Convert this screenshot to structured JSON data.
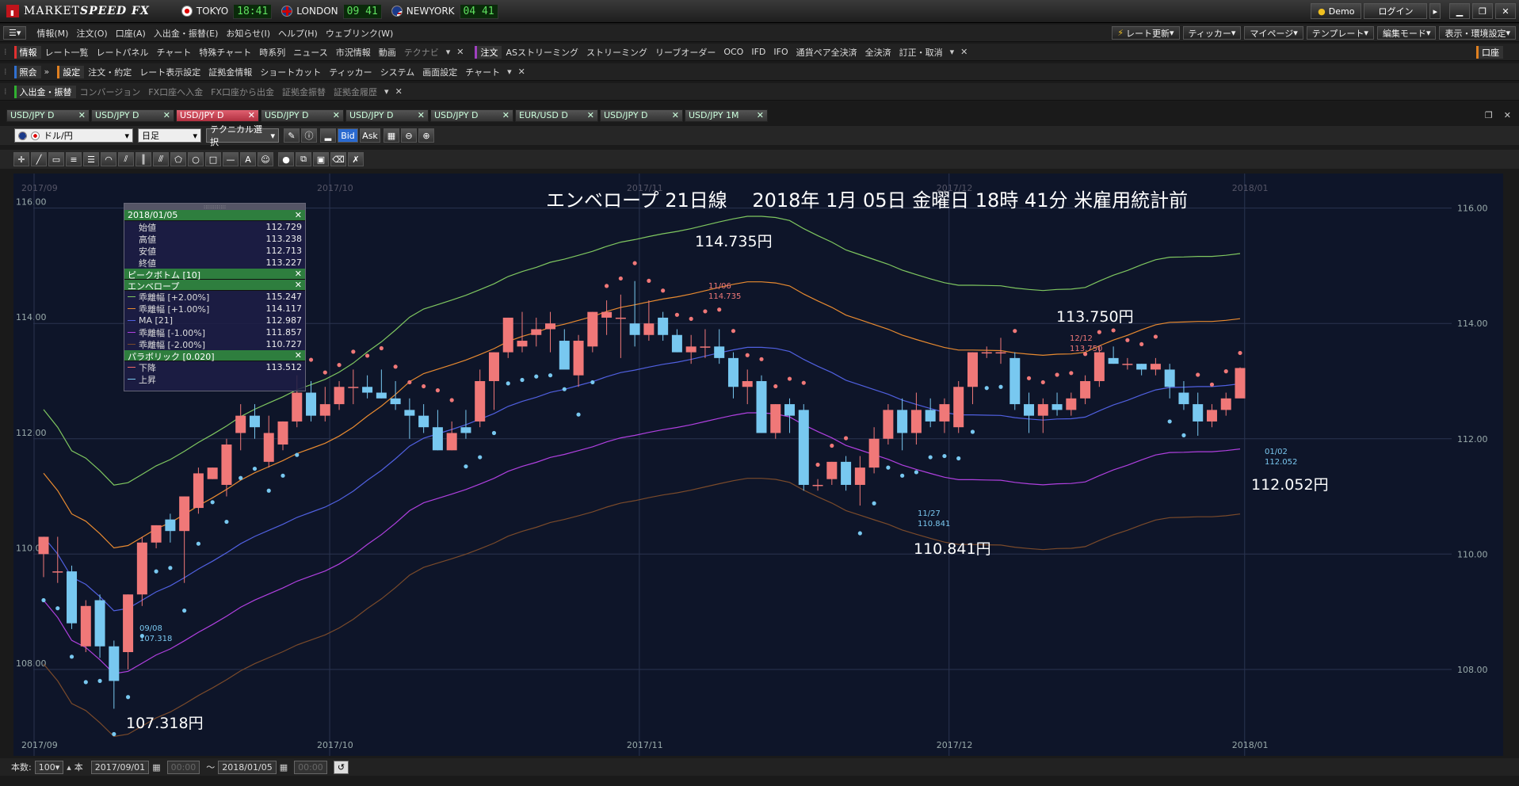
{
  "title_bar": {
    "app_name_a": "MARKET",
    "app_name_b": "SPEED FX",
    "clocks": [
      {
        "city": "TOKYO",
        "time": "18:41"
      },
      {
        "city": "LONDON",
        "time": "09 41"
      },
      {
        "city": "NEWYORK",
        "time": "04 41"
      }
    ],
    "demo_label": "Demo",
    "login_label": "ログイン"
  },
  "menu_row1": {
    "items": [
      "情報(M)",
      "注文(O)",
      "口座(A)",
      "入出金・振替(E)",
      "お知らせ(I)",
      "ヘルプ(H)",
      "ウェブリンク(W)"
    ],
    "right_buttons": [
      "レート更新",
      "ティッカー",
      "マイページ",
      "テンプレート",
      "編集モード",
      "表示・環境設定"
    ]
  },
  "menu_row2": {
    "group1_label": "情報",
    "group1_items": [
      "レート一覧",
      "レートパネル",
      "チャート",
      "特殊チャート",
      "時系列",
      "ニュース",
      "市況情報",
      "動画",
      "テクナビ"
    ],
    "group2_label": "注文",
    "group2_items": [
      "ASストリーミング",
      "ストリーミング",
      "リーブオーダー",
      "OCO",
      "IFD",
      "IFO",
      "通貨ペア全決済",
      "全決済",
      "訂正・取消"
    ],
    "right_label": "口座"
  },
  "menu_row3": {
    "group1_label": "照会",
    "group2_label": "設定",
    "group2_items": [
      "注文・約定",
      "レート表示設定",
      "証拠金情報",
      "ショートカット",
      "ティッカー",
      "システム",
      "画面設定",
      "チャート"
    ]
  },
  "menu_row4": {
    "group1_label": "入出金・振替",
    "group1_items": [
      "コンバージョン",
      "FX口座へ入金",
      "FX口座から出金",
      "証拠金振替",
      "証拠金履歴"
    ]
  },
  "tabs": [
    "USD/JPY D",
    "USD/JPY D",
    "USD/JPY D",
    "USD/JPY D",
    "USD/JPY D",
    "USD/JPY D",
    "EUR/USD D",
    "USD/JPY D",
    "USD/JPY 1M"
  ],
  "active_tab": 2,
  "chart_controls": {
    "pair": "ドル/円",
    "period": "日足",
    "technical": "テクニカル選択",
    "bid": "Bid",
    "ask": "Ask"
  },
  "legend": {
    "date": "2018/01/05",
    "ohlc": [
      {
        "name": "始値",
        "value": "112.729"
      },
      {
        "name": "高値",
        "value": "113.238"
      },
      {
        "name": "安値",
        "value": "112.713"
      },
      {
        "name": "終値",
        "value": "113.227"
      }
    ],
    "peak_bottom": "ピークボトム [10]",
    "envelope_title": "エンベロープ",
    "envelope": [
      {
        "name": "乖離幅 [+2.00%]",
        "value": "115.247",
        "color": "#7fc760"
      },
      {
        "name": "乖離幅 [+1.00%]",
        "value": "114.117",
        "color": "#e88a30"
      },
      {
        "name": "MA [21]",
        "value": "112.987",
        "color": "#5060e0"
      },
      {
        "name": "乖離幅 [-1.00%]",
        "value": "111.857",
        "color": "#b040e0"
      },
      {
        "name": "乖離幅 [-2.00%]",
        "value": "110.727",
        "color": "#7a4a2a"
      }
    ],
    "parabolic_title": "パラボリック [0.020]",
    "parabolic": [
      {
        "name": "下降",
        "value": "113.512",
        "color": "#f06a6a"
      },
      {
        "name": "上昇",
        "value": "",
        "color": "#7ac8f0"
      }
    ]
  },
  "headline": "エンベロープ 21日線　 2018年 1月 05日 金曜日 18時 41分 米雇用統計前",
  "annotations": {
    "a1": "114.735円",
    "a2": "113.750円",
    "a3": "112.052円",
    "a4": "110.841円",
    "a5": "107.318円",
    "p1_date": "11/06",
    "p1_val": "114.735",
    "p2_date": "12/12",
    "p2_val": "113.750",
    "p3_date": "01/02",
    "p3_val": "112.052",
    "p4_date": "11/27",
    "p4_val": "110.841",
    "p5_date": "09/08",
    "p5_val": "107.318"
  },
  "colors": {
    "up": "#f07878",
    "down": "#78c8f0",
    "bg": "#0e1529"
  },
  "footer": {
    "count_label": "本数:",
    "count_value": "100",
    "unit": "本",
    "from_date": "2017/09/01",
    "from_time": "00:00",
    "tilde": "〜",
    "to_date": "2018/01/05",
    "to_time": "00:00"
  },
  "chart_data": {
    "type": "candlestick",
    "y_ticks": [
      "116.00",
      "114.00",
      "112.00",
      "110.00",
      "108.00"
    ],
    "ylim": [
      106.5,
      116.6
    ],
    "x_ticks": [
      "2017/09",
      "2017/10",
      "2017/11",
      "2017/12",
      "2018/01"
    ],
    "candles": [
      [
        110.0,
        110.3,
        109.6,
        110.3
      ],
      [
        109.7,
        110.3,
        109.5,
        109.7
      ],
      [
        109.7,
        109.8,
        108.7,
        108.8
      ],
      [
        108.4,
        109.2,
        108.3,
        109.1
      ],
      [
        109.2,
        109.3,
        108.2,
        108.4
      ],
      [
        108.4,
        108.5,
        107.318,
        107.8
      ],
      [
        108.3,
        109.3,
        108.0,
        109.3
      ],
      [
        109.3,
        110.3,
        109.1,
        110.2
      ],
      [
        110.2,
        110.5,
        110.1,
        110.5
      ],
      [
        110.6,
        110.7,
        110.2,
        110.4
      ],
      [
        110.4,
        111.0,
        109.5,
        111.0
      ],
      [
        110.8,
        111.5,
        110.7,
        111.4
      ],
      [
        111.3,
        111.5,
        111.3,
        111.5
      ],
      [
        111.2,
        112.0,
        111.0,
        111.9
      ],
      [
        112.1,
        112.6,
        111.8,
        112.4
      ],
      [
        112.4,
        112.6,
        112.0,
        112.2
      ],
      [
        111.6,
        112.4,
        111.5,
        112.1
      ],
      [
        111.9,
        112.3,
        111.8,
        112.3
      ],
      [
        112.3,
        113.1,
        112.2,
        112.8
      ],
      [
        112.8,
        113.0,
        112.3,
        112.4
      ],
      [
        112.4,
        112.9,
        112.3,
        112.6
      ],
      [
        112.6,
        113.0,
        112.5,
        112.9
      ],
      [
        112.9,
        113.2,
        112.6,
        112.9
      ],
      [
        112.9,
        113.1,
        112.7,
        112.8
      ],
      [
        112.8,
        113.2,
        112.7,
        112.7
      ],
      [
        112.7,
        113.0,
        112.5,
        112.6
      ],
      [
        112.5,
        112.7,
        112.0,
        112.4
      ],
      [
        112.4,
        112.6,
        112.1,
        112.2
      ],
      [
        112.2,
        112.5,
        111.8,
        111.8
      ],
      [
        111.8,
        112.3,
        111.8,
        112.1
      ],
      [
        112.2,
        112.5,
        112.0,
        112.1
      ],
      [
        112.3,
        113.2,
        112.2,
        113.0
      ],
      [
        113.0,
        113.5,
        112.5,
        113.5
      ],
      [
        113.5,
        114.1,
        113.4,
        114.1
      ],
      [
        113.6,
        114.2,
        113.5,
        113.7
      ],
      [
        113.8,
        114.1,
        113.6,
        113.9
      ],
      [
        113.9,
        114.2,
        113.5,
        114.0
      ],
      [
        113.7,
        113.9,
        113.3,
        113.2
      ],
      [
        113.1,
        113.8,
        112.9,
        113.7
      ],
      [
        113.6,
        114.2,
        113.5,
        114.2
      ],
      [
        114.1,
        114.4,
        113.8,
        114.2
      ],
      [
        114.1,
        114.5,
        113.4,
        114.1
      ],
      [
        114.0,
        114.735,
        113.6,
        113.8
      ],
      [
        113.8,
        114.4,
        113.7,
        114.0
      ],
      [
        114.1,
        114.2,
        113.7,
        113.8
      ],
      [
        113.8,
        113.9,
        113.5,
        113.5
      ],
      [
        113.5,
        113.8,
        113.3,
        113.6
      ],
      [
        113.6,
        113.9,
        113.4,
        113.6
      ],
      [
        113.6,
        113.9,
        113.3,
        113.4
      ],
      [
        113.4,
        113.5,
        112.7,
        112.9
      ],
      [
        112.9,
        113.2,
        112.6,
        113.0
      ],
      [
        113.0,
        113.1,
        112.1,
        112.1
      ],
      [
        112.1,
        112.6,
        112.0,
        112.6
      ],
      [
        112.6,
        112.7,
        112.1,
        112.4
      ],
      [
        112.5,
        112.6,
        111.1,
        111.2
      ],
      [
        111.2,
        111.3,
        111.1,
        111.2
      ],
      [
        111.3,
        111.6,
        111.2,
        111.6
      ],
      [
        111.6,
        111.7,
        111.1,
        111.2
      ],
      [
        111.2,
        111.7,
        110.841,
        111.5
      ],
      [
        111.5,
        112.2,
        111.4,
        112.0
      ],
      [
        112.0,
        112.6,
        111.9,
        112.5
      ],
      [
        112.5,
        112.7,
        111.8,
        112.1
      ],
      [
        112.1,
        112.8,
        111.9,
        112.5
      ],
      [
        112.5,
        112.7,
        112.2,
        112.3
      ],
      [
        112.3,
        112.7,
        112.1,
        112.6
      ],
      [
        112.2,
        113.0,
        112.1,
        112.9
      ],
      [
        112.9,
        113.5,
        112.6,
        113.5
      ],
      [
        113.5,
        113.6,
        113.4,
        113.5
      ],
      [
        113.5,
        113.75,
        113.3,
        113.5
      ],
      [
        113.4,
        113.5,
        112.5,
        112.6
      ],
      [
        112.6,
        112.8,
        112.1,
        112.4
      ],
      [
        112.4,
        112.7,
        112.1,
        112.6
      ],
      [
        112.6,
        112.8,
        112.4,
        112.5
      ],
      [
        112.5,
        112.8,
        112.4,
        112.7
      ],
      [
        112.7,
        113.1,
        112.6,
        113.0
      ],
      [
        113.0,
        113.6,
        112.9,
        113.5
      ],
      [
        113.4,
        113.6,
        113.3,
        113.3
      ],
      [
        113.3,
        113.4,
        113.2,
        113.3
      ],
      [
        113.3,
        113.3,
        113.1,
        113.2
      ],
      [
        113.2,
        113.4,
        113.1,
        113.3
      ],
      [
        113.2,
        113.3,
        112.7,
        112.9
      ],
      [
        112.8,
        113.0,
        112.5,
        112.6
      ],
      [
        112.6,
        112.8,
        112.052,
        112.3
      ],
      [
        112.3,
        112.6,
        112.2,
        112.5
      ],
      [
        112.5,
        112.8,
        112.4,
        112.7
      ],
      [
        112.7,
        113.238,
        112.713,
        113.227
      ]
    ]
  }
}
